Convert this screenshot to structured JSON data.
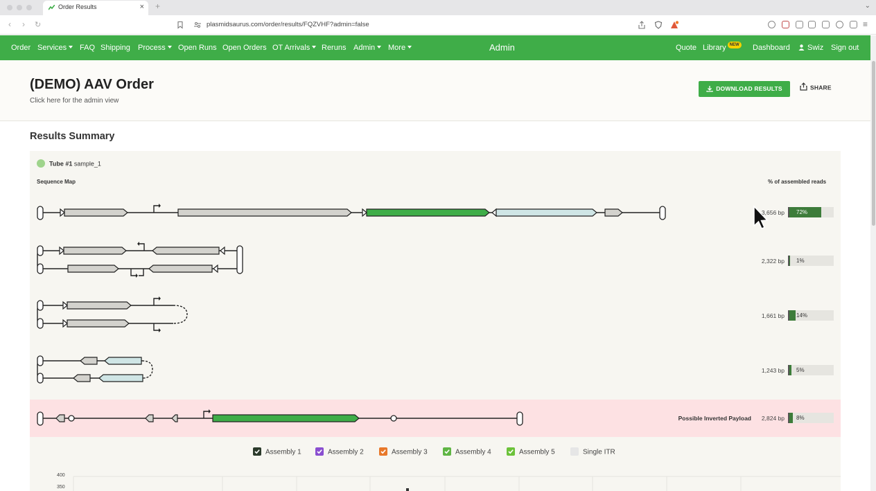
{
  "browser": {
    "tab_title": "Order Results",
    "url": "plasmidsaurus.com/order/results/FQZVHF?admin=false",
    "new_tab": "+",
    "tab_close": "×"
  },
  "nav": {
    "items": [
      {
        "label": "Order",
        "dropdown": false
      },
      {
        "label": "Services",
        "dropdown": true
      },
      {
        "label": "FAQ",
        "dropdown": false
      },
      {
        "label": "Shipping",
        "dropdown": false
      },
      {
        "label": "Process",
        "dropdown": true
      },
      {
        "label": "Open Runs",
        "dropdown": false
      },
      {
        "label": "Open Orders",
        "dropdown": false
      },
      {
        "label": "OT Arrivals",
        "dropdown": true
      },
      {
        "label": "Reruns",
        "dropdown": false
      },
      {
        "label": "Admin",
        "dropdown": true
      },
      {
        "label": "More",
        "dropdown": true
      }
    ],
    "center": "Admin",
    "right": {
      "quote": "Quote",
      "library": "Library",
      "library_badge": "NEW",
      "dashboard": "Dashboard",
      "user": "Swiz",
      "signout": "Sign out"
    },
    "brand_color": "#3fad48"
  },
  "header": {
    "title": "(DEMO) AAV Order",
    "subtitle": "Click here for the admin view",
    "download": "DOWNLOAD RESULTS",
    "share": "SHARE"
  },
  "summary": {
    "title": "Results Summary",
    "tube_label": "Tube #1",
    "tube_sample": "sample_1",
    "sequence_map": "Sequence Map",
    "pct_header": "% of assembled reads",
    "rows": [
      {
        "bp": "3,656 bp",
        "pct": "72%",
        "fraction": 0.72,
        "note": ""
      },
      {
        "bp": "2,322 bp",
        "pct": "1%",
        "fraction": 0.01,
        "note": ""
      },
      {
        "bp": "1,661 bp",
        "pct": "14%",
        "fraction": 0.14,
        "note": ""
      },
      {
        "bp": "1,243 bp",
        "pct": "5%",
        "fraction": 0.05,
        "note": ""
      },
      {
        "bp": "2,824 bp",
        "pct": "8%",
        "fraction": 0.08,
        "note": "Possible Inverted Payload"
      }
    ]
  },
  "legend": [
    {
      "label": "Assembly 1",
      "color": "#2b3a2b",
      "checked": true
    },
    {
      "label": "Assembly 2",
      "color": "#8a4fd0",
      "checked": true
    },
    {
      "label": "Assembly 3",
      "color": "#e8782a",
      "checked": true
    },
    {
      "label": "Assembly 4",
      "color": "#5fb544",
      "checked": true
    },
    {
      "label": "Assembly 5",
      "color": "#6cc23a",
      "checked": true
    },
    {
      "label": "Single ITR",
      "color": "#e6e6e6",
      "checked": false
    }
  ],
  "chart_axis": {
    "ticks": [
      "400",
      "350"
    ]
  }
}
